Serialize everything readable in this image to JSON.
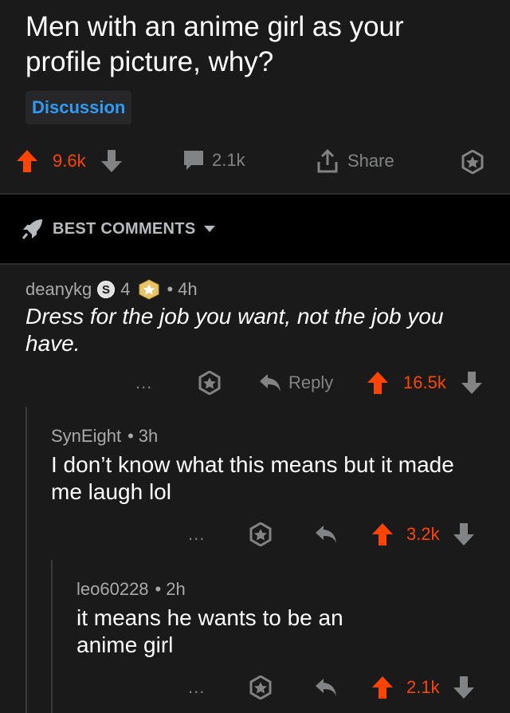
{
  "post": {
    "title": "Men with an anime girl as your profile picture, why?",
    "flair": "Discussion",
    "upvotes": "9.6k",
    "comments": "2.1k",
    "share_label": "Share"
  },
  "sort": {
    "label": "BEST COMMENTS"
  },
  "comments": [
    {
      "author": "deanykg",
      "badge_count": "4",
      "time": "4h",
      "text": "Dress for the job you want, not the job you have.",
      "more": "...",
      "reply_label": "Reply",
      "score": "16.5k"
    },
    {
      "author": "SynEight",
      "time": "3h",
      "text": "I don’t know what this means but it made me laugh lol",
      "more": "...",
      "score": "3.2k"
    },
    {
      "author": "leo60228",
      "time": "2h",
      "text": "it means he wants to be an anime girl",
      "more": "...",
      "score": "2.1k"
    }
  ],
  "colors": {
    "upvote": "#ff4500",
    "accent": "#2f9bf5",
    "background": "#1a1a1b"
  }
}
